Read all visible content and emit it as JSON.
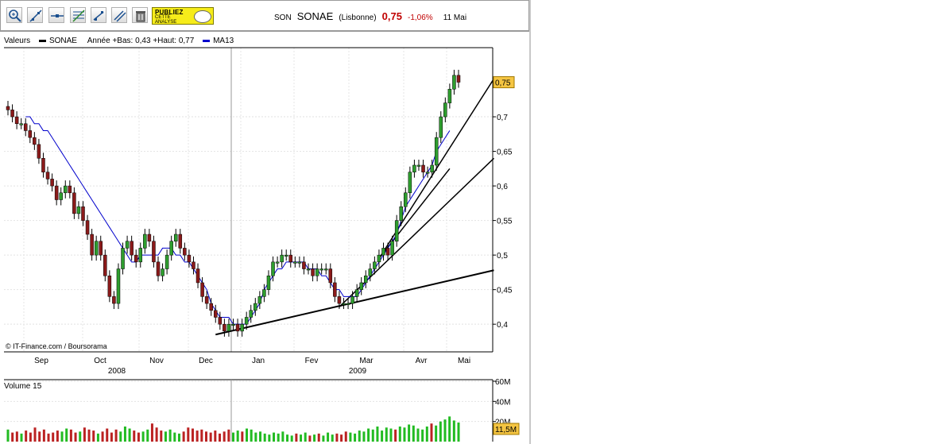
{
  "toolbar": {
    "tools": [
      {
        "id": "zoom",
        "icon": "magnifier-icon"
      },
      {
        "id": "trend",
        "icon": "trendline-icon"
      },
      {
        "id": "horizontal",
        "icon": "horizontal-line-icon"
      },
      {
        "id": "fibo",
        "icon": "fibonacci-icon"
      },
      {
        "id": "channel",
        "icon": "channel-icon"
      },
      {
        "id": "parallel",
        "icon": "parallel-lines-icon"
      },
      {
        "id": "trash",
        "icon": "trash-icon"
      }
    ],
    "ad": {
      "line1": "PUBLIEZ",
      "line2": "CETTE",
      "line3": "ANALYSE"
    }
  },
  "quote": {
    "ticker": "SON",
    "name": "SONAE",
    "market": "(Lisbonne)",
    "price": "0,75",
    "change": "-1,06%",
    "date": "11 Mai"
  },
  "legend": {
    "values_label": "Valeurs",
    "series_label": "SONAE",
    "range_text": "Année +Bas: 0,43 +Haut: 0,77",
    "ma_label": "MA13",
    "series_color": "#000000",
    "ma_color": "#0000cc"
  },
  "credit": "© IT-Finance.com / Boursorama",
  "volume_label": "Volume 15",
  "chart_data": [
    {
      "type": "candlestick",
      "name": "price",
      "ylim": [
        0.36,
        0.8
      ],
      "y_ticks": [
        "0,4",
        "0,45",
        "0,5",
        "0,55",
        "0,6",
        "0,65",
        "0,7"
      ],
      "y_tick_values": [
        0.4,
        0.45,
        0.5,
        0.55,
        0.6,
        0.65,
        0.7
      ],
      "last_label": "0,75",
      "last_value": 0.75,
      "x_months": [
        "Sep",
        "Oct",
        "Nov",
        "Dec",
        "Jan",
        "Fev",
        "Mar",
        "Avr",
        "Mai"
      ],
      "x_years": [
        "2008",
        "2009"
      ],
      "series_close": [
        0.71,
        0.7,
        0.69,
        0.69,
        0.68,
        0.67,
        0.66,
        0.64,
        0.62,
        0.61,
        0.6,
        0.58,
        0.59,
        0.6,
        0.59,
        0.56,
        0.57,
        0.55,
        0.53,
        0.5,
        0.52,
        0.5,
        0.47,
        0.44,
        0.43,
        0.48,
        0.51,
        0.52,
        0.5,
        0.49,
        0.51,
        0.53,
        0.52,
        0.49,
        0.47,
        0.48,
        0.5,
        0.52,
        0.53,
        0.51,
        0.5,
        0.49,
        0.48,
        0.46,
        0.44,
        0.43,
        0.42,
        0.41,
        0.4,
        0.39,
        0.4,
        0.4,
        0.39,
        0.4,
        0.41,
        0.42,
        0.43,
        0.44,
        0.45,
        0.47,
        0.49,
        0.49,
        0.5,
        0.5,
        0.49,
        0.49,
        0.49,
        0.48,
        0.48,
        0.47,
        0.48,
        0.48,
        0.48,
        0.46,
        0.44,
        0.43,
        0.43,
        0.43,
        0.44,
        0.45,
        0.46,
        0.47,
        0.48,
        0.49,
        0.5,
        0.51,
        0.5,
        0.52,
        0.55,
        0.57,
        0.59,
        0.62,
        0.63,
        0.63,
        0.62,
        0.62,
        0.63,
        0.67,
        0.7,
        0.72,
        0.74,
        0.76,
        0.75
      ],
      "ma13": [
        0.7,
        0.7,
        0.69,
        0.69,
        0.68,
        0.68,
        0.67,
        0.66,
        0.65,
        0.64,
        0.63,
        0.62,
        0.61,
        0.6,
        0.59,
        0.58,
        0.57,
        0.56,
        0.55,
        0.54,
        0.53,
        0.52,
        0.51,
        0.5,
        0.49,
        0.49,
        0.5,
        0.5,
        0.5,
        0.5,
        0.5,
        0.51,
        0.51,
        0.51,
        0.5,
        0.5,
        0.49,
        0.49,
        0.48,
        0.47,
        0.46,
        0.45,
        0.43,
        0.42,
        0.41,
        0.41,
        0.41,
        0.4,
        0.4,
        0.4,
        0.4,
        0.41,
        0.42,
        0.43,
        0.45,
        0.46,
        0.47,
        0.48,
        0.48,
        0.49,
        0.49,
        0.49,
        0.49,
        0.49,
        0.48,
        0.48,
        0.48,
        0.47,
        0.47,
        0.46,
        0.45,
        0.45,
        0.44,
        0.44,
        0.44,
        0.44,
        0.45,
        0.46,
        0.47,
        0.48,
        0.49,
        0.5,
        0.51,
        0.52,
        0.53,
        0.55,
        0.57,
        0.58,
        0.59,
        0.6,
        0.61,
        0.62,
        0.63,
        0.65,
        0.66,
        0.67,
        0.68
      ]
    },
    {
      "type": "bar",
      "name": "volume",
      "ylim": [
        0,
        60
      ],
      "y_ticks": [
        "20M",
        "40M",
        "60M"
      ],
      "y_tick_values": [
        20,
        40,
        60
      ],
      "last_label": "11,5M",
      "values": [
        12,
        9,
        10,
        8,
        11,
        9,
        14,
        10,
        12,
        8,
        9,
        11,
        10,
        13,
        12,
        9,
        10,
        14,
        12,
        11,
        8,
        10,
        13,
        9,
        12,
        10,
        15,
        13,
        11,
        9,
        10,
        12,
        18,
        14,
        11,
        10,
        12,
        9,
        8,
        10,
        14,
        13,
        11,
        12,
        10,
        9,
        11,
        8,
        10,
        12,
        9,
        11,
        10,
        13,
        12,
        9,
        10,
        8,
        7,
        9,
        8,
        10,
        7,
        6,
        8,
        7,
        9,
        6,
        7,
        8,
        6,
        9,
        7,
        8,
        7,
        10,
        9,
        8,
        11,
        10,
        13,
        12,
        15,
        11,
        14,
        13,
        12,
        15,
        14,
        17,
        16,
        13,
        12,
        15,
        18,
        16,
        20,
        22,
        25,
        21,
        19
      ]
    }
  ]
}
